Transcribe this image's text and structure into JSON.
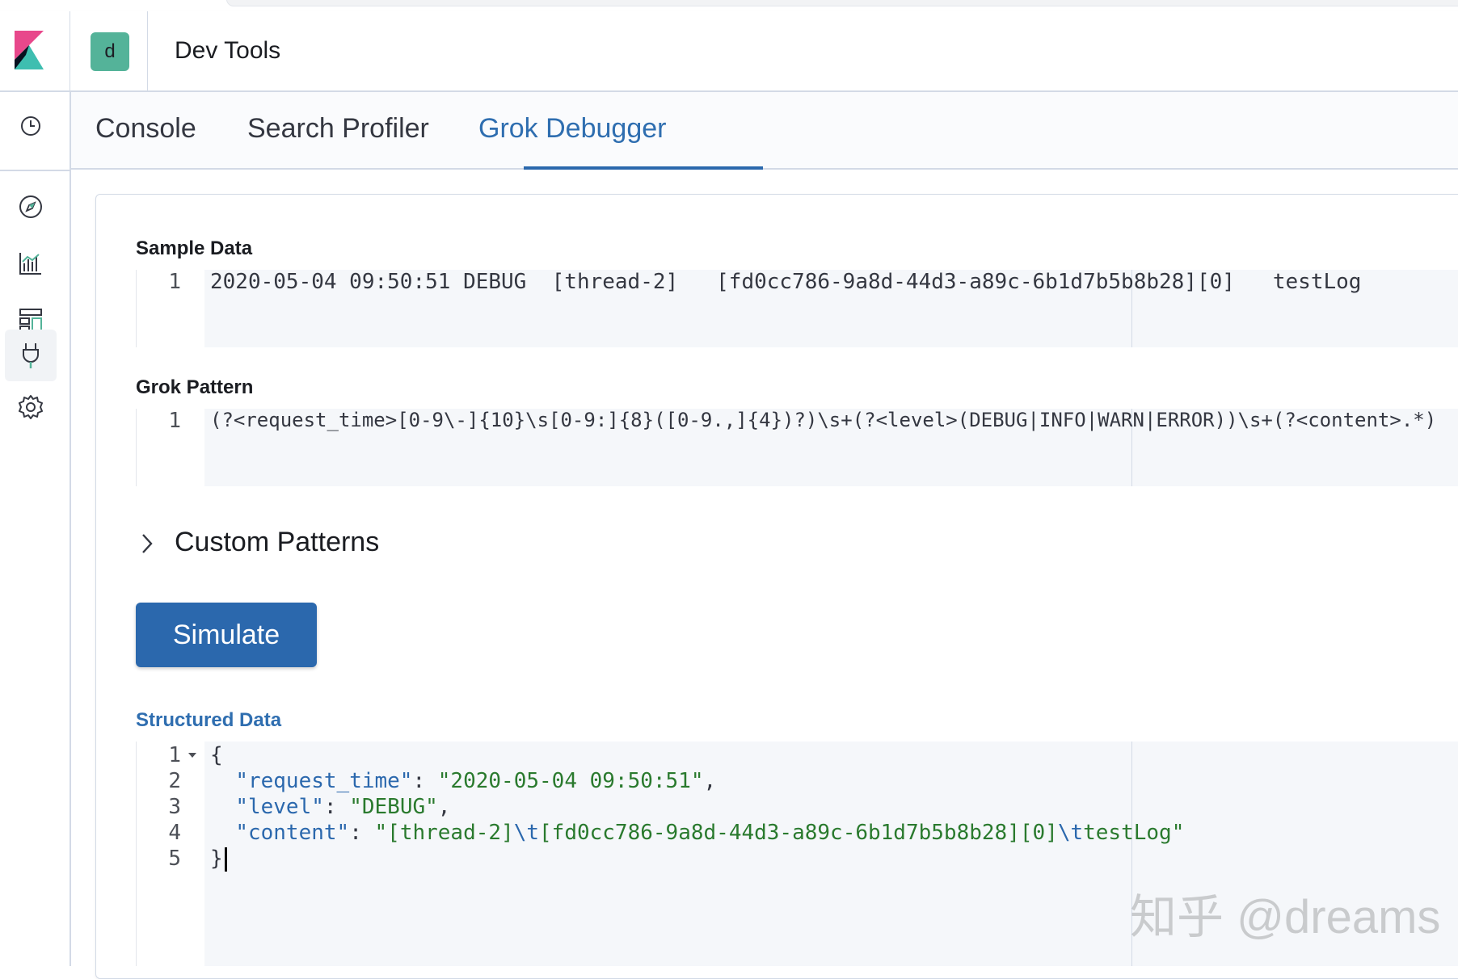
{
  "header": {
    "space_letter": "d",
    "app_title": "Dev Tools"
  },
  "sidenav": {
    "items": [
      "clock-icon",
      "compass-icon",
      "visualize-icon",
      "dashboard-icon",
      "devtools-icon",
      "gear-icon"
    ],
    "active_index": 4
  },
  "tabs": [
    {
      "label": "Console",
      "active": false
    },
    {
      "label": "Search Profiler",
      "active": false
    },
    {
      "label": "Grok Debugger",
      "active": true
    }
  ],
  "sample_data": {
    "label": "Sample Data",
    "line_number": "1",
    "text": "2020-05-04 09:50:51 DEBUG  [thread-2]   [fd0cc786-9a8d-44d3-a89c-6b1d7b5b8b28][0]   testLog"
  },
  "grok_pattern": {
    "label": "Grok Pattern",
    "line_number": "1",
    "text": "(?<request_time>[0-9\\-]{10}\\s[0-9:]{8}([0-9.,]{4})?)\\s+(?<level>(DEBUG|INFO|WARN|ERROR))\\s+(?<content>.*)"
  },
  "custom_patterns": {
    "label": "Custom Patterns"
  },
  "simulate_button": {
    "label": "Simulate"
  },
  "structured_data": {
    "label": "Structured Data",
    "line_numbers": [
      "1",
      "2",
      "3",
      "4",
      "5"
    ],
    "open_brace": "{",
    "close_brace": "}",
    "key1": "\"request_time\"",
    "val1": "\"2020-05-04 09:50:51\"",
    "key2": "\"level\"",
    "val2": "\"DEBUG\"",
    "key3": "\"content\"",
    "val3_a": "\"[thread-2]",
    "val3_esc1": "\\t",
    "val3_b": "[fd0cc786-9a8d-44d3-a89c-6b1d7b5b8b28][0]",
    "val3_esc2": "\\t",
    "val3_c": "testLog\"",
    "colon": ": ",
    "comma": ","
  },
  "watermark": "知乎 @dreams"
}
